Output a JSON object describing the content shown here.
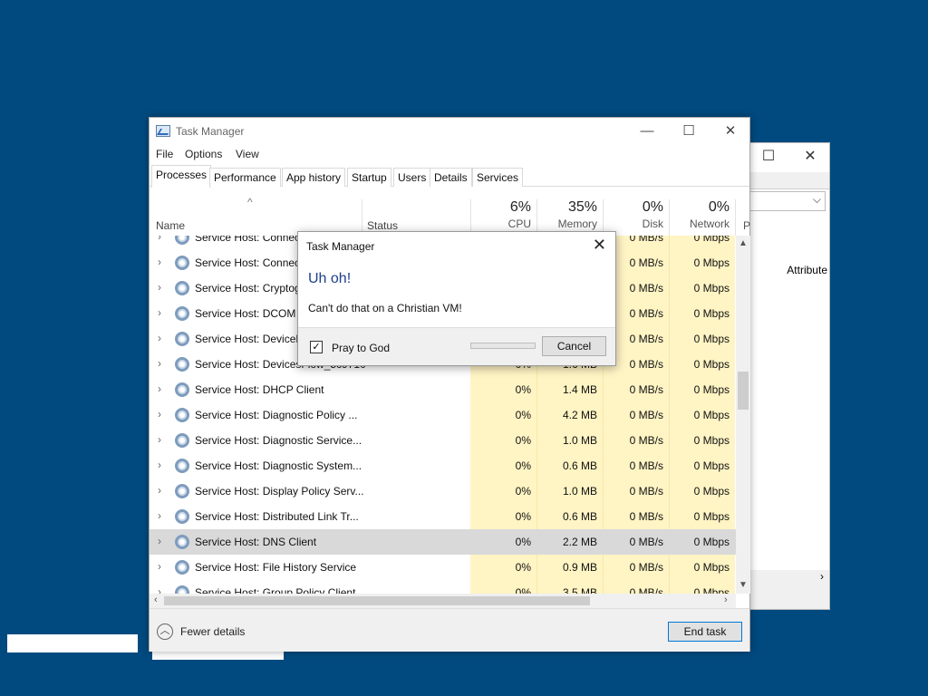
{
  "window": {
    "title": "Task Manager",
    "menu": [
      "File",
      "Options",
      "View"
    ],
    "tabs": [
      "Processes",
      "Performance",
      "App history",
      "Startup",
      "Users",
      "Details",
      "Services"
    ],
    "active_tab": "Processes"
  },
  "columns": {
    "name": "Name",
    "status": "Status",
    "cpu": {
      "pct": "6%",
      "label": "CPU"
    },
    "memory": {
      "pct": "35%",
      "label": "Memory"
    },
    "disk": {
      "pct": "0%",
      "label": "Disk"
    },
    "network": {
      "pct": "0%",
      "label": "Network"
    },
    "power_partial": "P"
  },
  "rows": [
    {
      "name": "Service Host: Connec",
      "cpu": "",
      "memory": "",
      "disk": "0 MB/s",
      "network": "0 Mbps"
    },
    {
      "name": "Service Host: Connec",
      "cpu": "",
      "memory": "",
      "disk": "0 MB/s",
      "network": "0 Mbps"
    },
    {
      "name": "Service Host: Cryptog",
      "cpu": "",
      "memory": "",
      "disk": "0 MB/s",
      "network": "0 Mbps"
    },
    {
      "name": "Service Host: DCOM S",
      "cpu": "",
      "memory": "",
      "disk": "0 MB/s",
      "network": "0 Mbps"
    },
    {
      "name": "Service Host: DeviceP",
      "cpu": "",
      "memory": "",
      "disk": "0 MB/s",
      "network": "0 Mbps"
    },
    {
      "name": "Service Host: DevicesFlow_5c9710",
      "cpu": "0%",
      "memory": "1.6 MB",
      "disk": "0 MB/s",
      "network": "0 Mbps"
    },
    {
      "name": "Service Host: DHCP Client",
      "cpu": "0%",
      "memory": "1.4 MB",
      "disk": "0 MB/s",
      "network": "0 Mbps"
    },
    {
      "name": "Service Host: Diagnostic Policy ...",
      "cpu": "0%",
      "memory": "4.2 MB",
      "disk": "0 MB/s",
      "network": "0 Mbps"
    },
    {
      "name": "Service Host: Diagnostic Service...",
      "cpu": "0%",
      "memory": "1.0 MB",
      "disk": "0 MB/s",
      "network": "0 Mbps"
    },
    {
      "name": "Service Host: Diagnostic System...",
      "cpu": "0%",
      "memory": "0.6 MB",
      "disk": "0 MB/s",
      "network": "0 Mbps"
    },
    {
      "name": "Service Host: Display Policy Serv...",
      "cpu": "0%",
      "memory": "1.0 MB",
      "disk": "0 MB/s",
      "network": "0 Mbps"
    },
    {
      "name": "Service Host: Distributed Link Tr...",
      "cpu": "0%",
      "memory": "0.6 MB",
      "disk": "0 MB/s",
      "network": "0 Mbps"
    },
    {
      "name": "Service Host: DNS Client",
      "cpu": "0%",
      "memory": "2.2 MB",
      "disk": "0 MB/s",
      "network": "0 Mbps",
      "selected": true
    },
    {
      "name": "Service Host: File History Service",
      "cpu": "0%",
      "memory": "0.9 MB",
      "disk": "0 MB/s",
      "network": "0 Mbps"
    },
    {
      "name": "Service Host: Group Policy Client",
      "cpu": "0%",
      "memory": "3.5 MB",
      "disk": "0 MB/s",
      "network": "0 Mbps"
    }
  ],
  "footer": {
    "fewer_details": "Fewer details",
    "end_task": "End task"
  },
  "dialog": {
    "title": "Task Manager",
    "heading": "Uh oh!",
    "message": "Can't do that on a Christian VM!",
    "checkbox_label": "Pray to God",
    "checkbox_checked": true,
    "cancel": "Cancel"
  },
  "back_window": {
    "attribute_label": "Attribute"
  },
  "colors": {
    "desktop": "#004a7f",
    "heat": "#fff4c4",
    "selection": "#d9d9d9",
    "accent": "#0078d7"
  }
}
